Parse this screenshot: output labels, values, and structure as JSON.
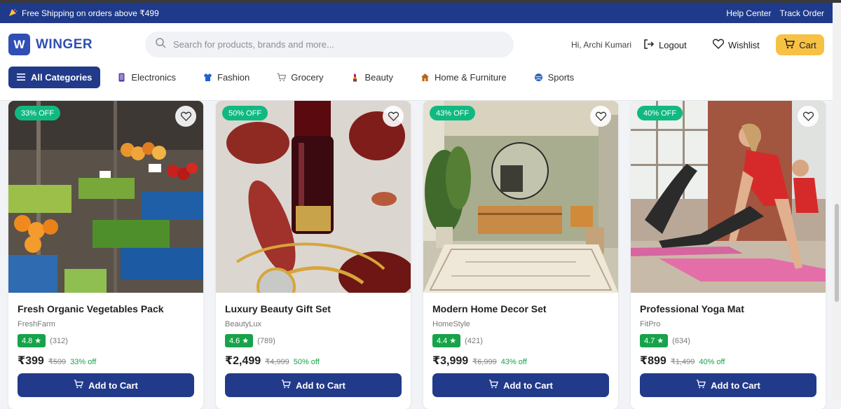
{
  "promo": {
    "icon": "party-icon",
    "text": "Free Shipping on orders above ₹499",
    "links": [
      "Help Center",
      "Track Order"
    ]
  },
  "header": {
    "logo_letter": "W",
    "logo_text": "WINGER",
    "search_placeholder": "Search for products, brands and more...",
    "greeting": "Hi, Archi Kumari",
    "logout_label": "Logout",
    "wishlist_label": "Wishlist",
    "cart_label": "Cart"
  },
  "nav": {
    "all_categories": "All Categories",
    "items": [
      {
        "label": "Electronics",
        "icon": "phone-icon",
        "color": "#5b3fa0"
      },
      {
        "label": "Fashion",
        "icon": "shirt-icon",
        "color": "#1e63d6"
      },
      {
        "label": "Grocery",
        "icon": "cart-icon",
        "color": "#8a8a8a"
      },
      {
        "label": "Beauty",
        "icon": "lipstick-icon",
        "color": "#c2185b"
      },
      {
        "label": "Home & Furniture",
        "icon": "house-icon",
        "color": "#b5651d"
      },
      {
        "label": "Sports",
        "icon": "ball-icon",
        "color": "#2a63c4"
      }
    ]
  },
  "products": [
    {
      "badge": "33% OFF",
      "title": "Fresh Organic Vegetables Pack",
      "brand": "FreshFarm",
      "rating": "4.8",
      "reviews": "(312)",
      "price": "₹399",
      "mrp": "₹599",
      "off": "33% off",
      "button": "Add to Cart"
    },
    {
      "badge": "50% OFF",
      "title": "Luxury Beauty Gift Set",
      "brand": "BeautyLux",
      "rating": "4.6",
      "reviews": "(789)",
      "price": "₹2,499",
      "mrp": "₹4,999",
      "off": "50% off",
      "button": "Add to Cart"
    },
    {
      "badge": "43% OFF",
      "title": "Modern Home Decor Set",
      "brand": "HomeStyle",
      "rating": "4.4",
      "reviews": "(421)",
      "price": "₹3,999",
      "mrp": "₹6,999",
      "off": "43% off",
      "button": "Add to Cart"
    },
    {
      "badge": "40% OFF",
      "title": "Professional Yoga Mat",
      "brand": "FitPro",
      "rating": "4.7",
      "reviews": "(634)",
      "price": "₹899",
      "mrp": "₹1,499",
      "off": "40% off",
      "button": "Add to Cart"
    }
  ],
  "colors": {
    "brand": "#213a8a",
    "accent": "#f7c144",
    "success": "#16a34a",
    "badge": "#10b981"
  }
}
